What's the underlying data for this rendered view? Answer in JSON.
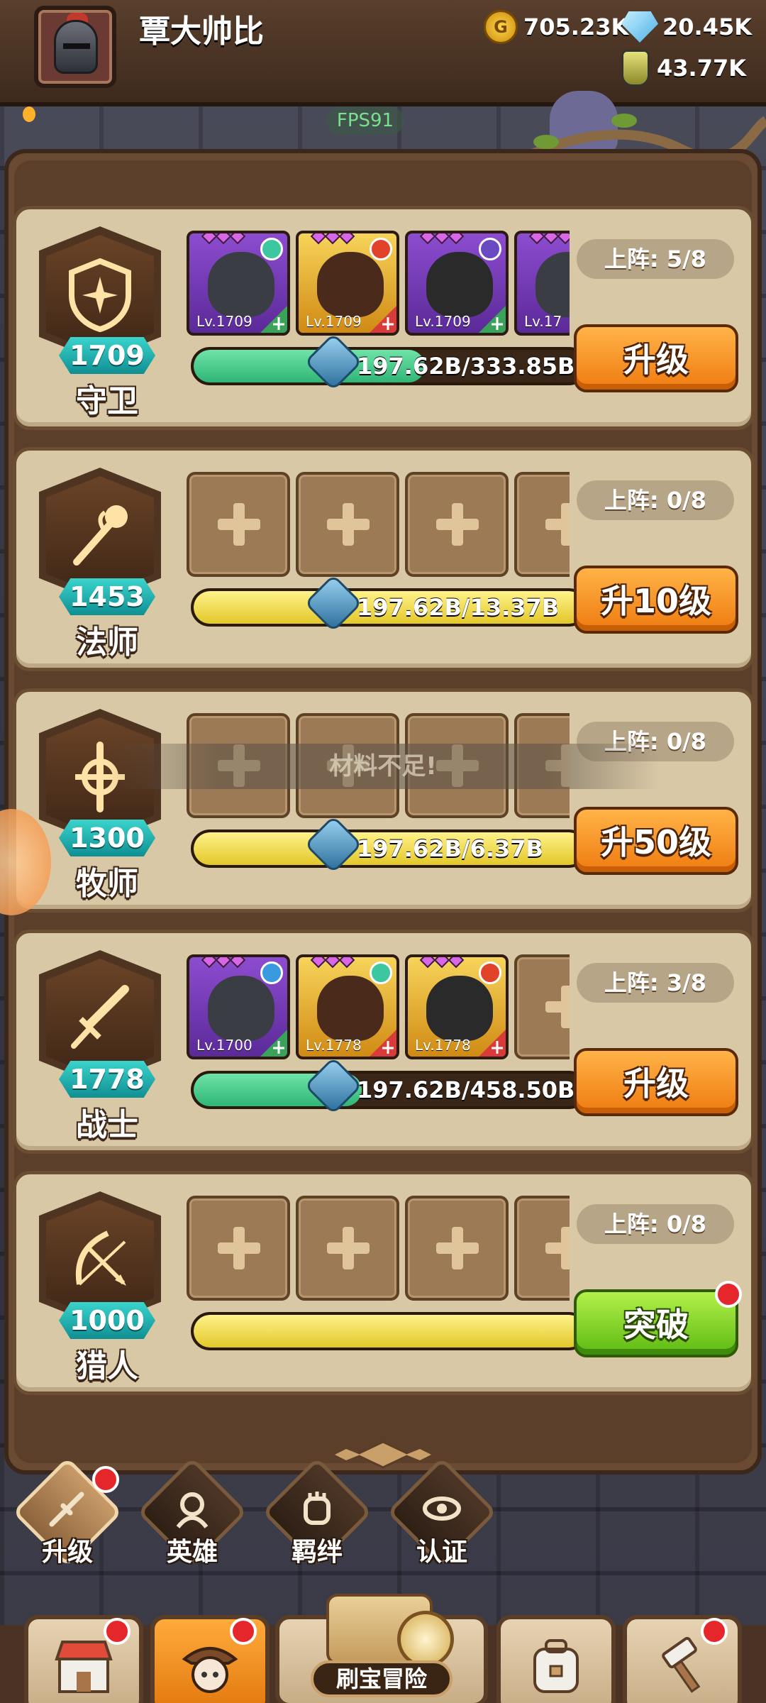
{
  "header": {
    "player_name": "覃大帅比",
    "gold": "705.23K",
    "gems": "20.45K",
    "potions": "43.77K",
    "fps": "FPS91"
  },
  "rows": [
    {
      "class_name": "守卫",
      "level": "1709",
      "seat_label": "上阵: 5/8",
      "progress_text": "197.62B/333.85B",
      "progress_fill": 0.59,
      "button_label": "升级",
      "button_style": "orange",
      "heroes": [
        {
          "level": "Lv.1709",
          "frame": "purple",
          "element": "wind",
          "role": "shield"
        },
        {
          "level": "Lv.1709",
          "frame": "gold",
          "element": "fire",
          "role": "shield"
        },
        {
          "level": "Lv.1709",
          "frame": "purple",
          "element": "dark",
          "role": "shield"
        },
        {
          "level": "Lv.17",
          "frame": "purple",
          "element": "none",
          "role": "shield"
        }
      ]
    },
    {
      "class_name": "法师",
      "level": "1453",
      "seat_label": "上阵: 0/8",
      "progress_text": "197.62B/13.37B",
      "progress_fill": 1.0,
      "button_label": "升10级",
      "button_style": "orange",
      "heroes": []
    },
    {
      "class_name": "牧师",
      "level": "1300",
      "seat_label": "上阵: 0/8",
      "progress_text": "197.62B/6.37B",
      "progress_fill": 1.0,
      "button_label": "升50级",
      "button_style": "orange",
      "heroes": []
    },
    {
      "class_name": "战士",
      "level": "1778",
      "seat_label": "上阵: 3/8",
      "progress_text": "197.62B/458.50B",
      "progress_fill": 0.43,
      "button_label": "升级",
      "button_style": "orange",
      "heroes": [
        {
          "level": "Lv.1700",
          "frame": "purple",
          "element": "water",
          "role": "sword"
        },
        {
          "level": "Lv.1778",
          "frame": "gold",
          "element": "wind",
          "role": "sword"
        },
        {
          "level": "Lv.1778",
          "frame": "gold",
          "element": "fire",
          "role": "sword"
        }
      ]
    },
    {
      "class_name": "猎人",
      "level": "1000",
      "seat_label": "上阵: 0/8",
      "progress_text": "",
      "progress_fill": 1.0,
      "button_label": "突破",
      "button_style": "green",
      "heroes": []
    }
  ],
  "toast": "材料不足!",
  "sub_tabs": [
    {
      "label": "升级",
      "icon": "upgrade-sword-icon",
      "active": true,
      "badge": true
    },
    {
      "label": "英雄",
      "icon": "hero-icon",
      "active": false,
      "badge": false
    },
    {
      "label": "羁绊",
      "icon": "bond-fist-icon",
      "active": false,
      "badge": false
    },
    {
      "label": "认证",
      "icon": "eye-icon",
      "active": false,
      "badge": false
    }
  ],
  "bottom_nav": {
    "adventure_label": "刷宝冒险"
  },
  "colors": {
    "accent_orange": "#ef7b10",
    "accent_green": "#5cba12",
    "progress_green": "#2fb676",
    "progress_yellow": "#e3c82a",
    "level_badge": "#1fb3b3",
    "badge_red": "#e5262a"
  }
}
